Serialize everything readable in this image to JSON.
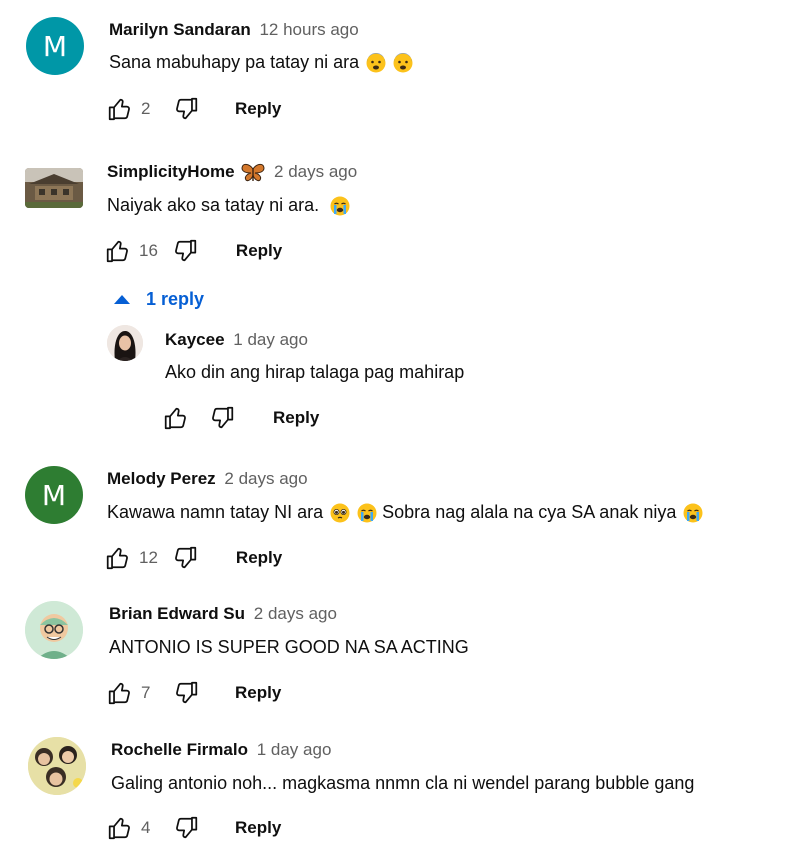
{
  "colors": {
    "accent_blue": "#065fd4",
    "avatar_teal": "#0097a7",
    "avatar_green": "#2e7d32",
    "muted_text": "#606060"
  },
  "comments": [
    {
      "author": "Marilyn Sandaran",
      "time": "12 hours ago",
      "text": "Sana mabuhapy pa tatay ni ara",
      "emojis": [
        "worried-face-emoji",
        "worried-face-emoji"
      ],
      "avatar_letter": "M",
      "likes": "2",
      "reply_label": "Reply"
    },
    {
      "author": "SimplicityHome",
      "author_badge": "butterfly-emoji",
      "time": "2 days ago",
      "text": "Naiyak ako sa tatay ni ara.",
      "emojis": [
        "loudly-crying-face-emoji"
      ],
      "likes": "16",
      "reply_label": "Reply",
      "replies_toggle": "1 reply",
      "replies": [
        {
          "author": "Kaycee",
          "time": "1 day ago",
          "text": "Ako din ang hirap talaga pag mahirap",
          "likes": "",
          "reply_label": "Reply"
        }
      ]
    },
    {
      "author": "Melody Perez",
      "time": "2 days ago",
      "text_parts": [
        "Kawawa namn tatay NI ara",
        "Sobra nag alala na cya SA anak niya"
      ],
      "avatar_letter": "M",
      "likes": "12",
      "reply_label": "Reply"
    },
    {
      "author": "Brian Edward Su",
      "time": "2 days ago",
      "text": "ANTONIO IS SUPER GOOD NA SA ACTING",
      "likes": "7",
      "reply_label": "Reply"
    },
    {
      "author": "Rochelle Firmalo",
      "time": "1 day ago",
      "text": "Galing antonio noh... magkasma nnmn cla ni wendel parang bubble gang",
      "likes": "4",
      "reply_label": "Reply"
    }
  ]
}
